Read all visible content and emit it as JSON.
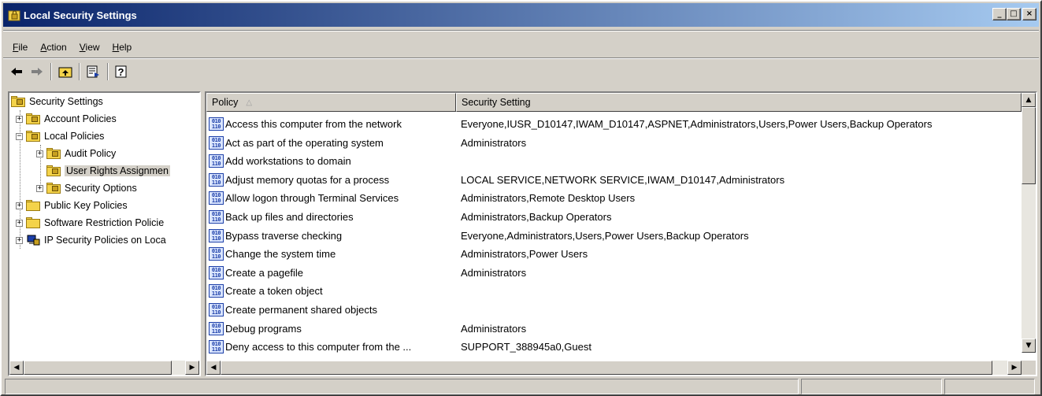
{
  "window": {
    "title": "Local Security Settings",
    "minimize": "_",
    "maximize": "□",
    "close": "×"
  },
  "menu": [
    {
      "label": "File",
      "mnemonic": "F",
      "rest": "ile"
    },
    {
      "label": "Action",
      "mnemonic": "A",
      "rest": "ction"
    },
    {
      "label": "View",
      "mnemonic": "V",
      "rest": "iew"
    },
    {
      "label": "Help",
      "mnemonic": "H",
      "rest": "elp"
    }
  ],
  "toolbar": {
    "back_icon": "arrow-left-icon",
    "forward_icon": "arrow-right-icon",
    "up_icon": "up-folder-icon",
    "export_icon": "export-list-icon",
    "help_icon": "help-icon"
  },
  "tree": {
    "root": "Security Settings",
    "account_policies": "Account Policies",
    "local_policies": "Local Policies",
    "audit_policy": "Audit Policy",
    "user_rights": "User Rights Assignmen",
    "security_options": "Security Options",
    "public_key": "Public Key Policies",
    "software_restriction": "Software Restriction Policie",
    "ip_security": "IP Security Policies on Loca"
  },
  "list": {
    "col_policy": "Policy",
    "col_setting": "Security Setting",
    "rows": [
      {
        "policy": "Access this computer from the network",
        "setting": "Everyone,IUSR_D10147,IWAM_D10147,ASPNET,Administrators,Users,Power Users,Backup Operators"
      },
      {
        "policy": "Act as part of the operating system",
        "setting": "Administrators"
      },
      {
        "policy": "Add workstations to domain",
        "setting": ""
      },
      {
        "policy": "Adjust memory quotas for a process",
        "setting": "LOCAL SERVICE,NETWORK SERVICE,IWAM_D10147,Administrators"
      },
      {
        "policy": "Allow logon through Terminal Services",
        "setting": "Administrators,Remote Desktop Users"
      },
      {
        "policy": "Back up files and directories",
        "setting": "Administrators,Backup Operators"
      },
      {
        "policy": "Bypass traverse checking",
        "setting": "Everyone,Administrators,Users,Power Users,Backup Operators"
      },
      {
        "policy": "Change the system time",
        "setting": "Administrators,Power Users"
      },
      {
        "policy": "Create a pagefile",
        "setting": "Administrators"
      },
      {
        "policy": "Create a token object",
        "setting": ""
      },
      {
        "policy": "Create permanent shared objects",
        "setting": ""
      },
      {
        "policy": "Debug programs",
        "setting": "Administrators"
      },
      {
        "policy": "Deny access to this computer from the ...",
        "setting": "SUPPORT_388945a0,Guest"
      }
    ]
  }
}
